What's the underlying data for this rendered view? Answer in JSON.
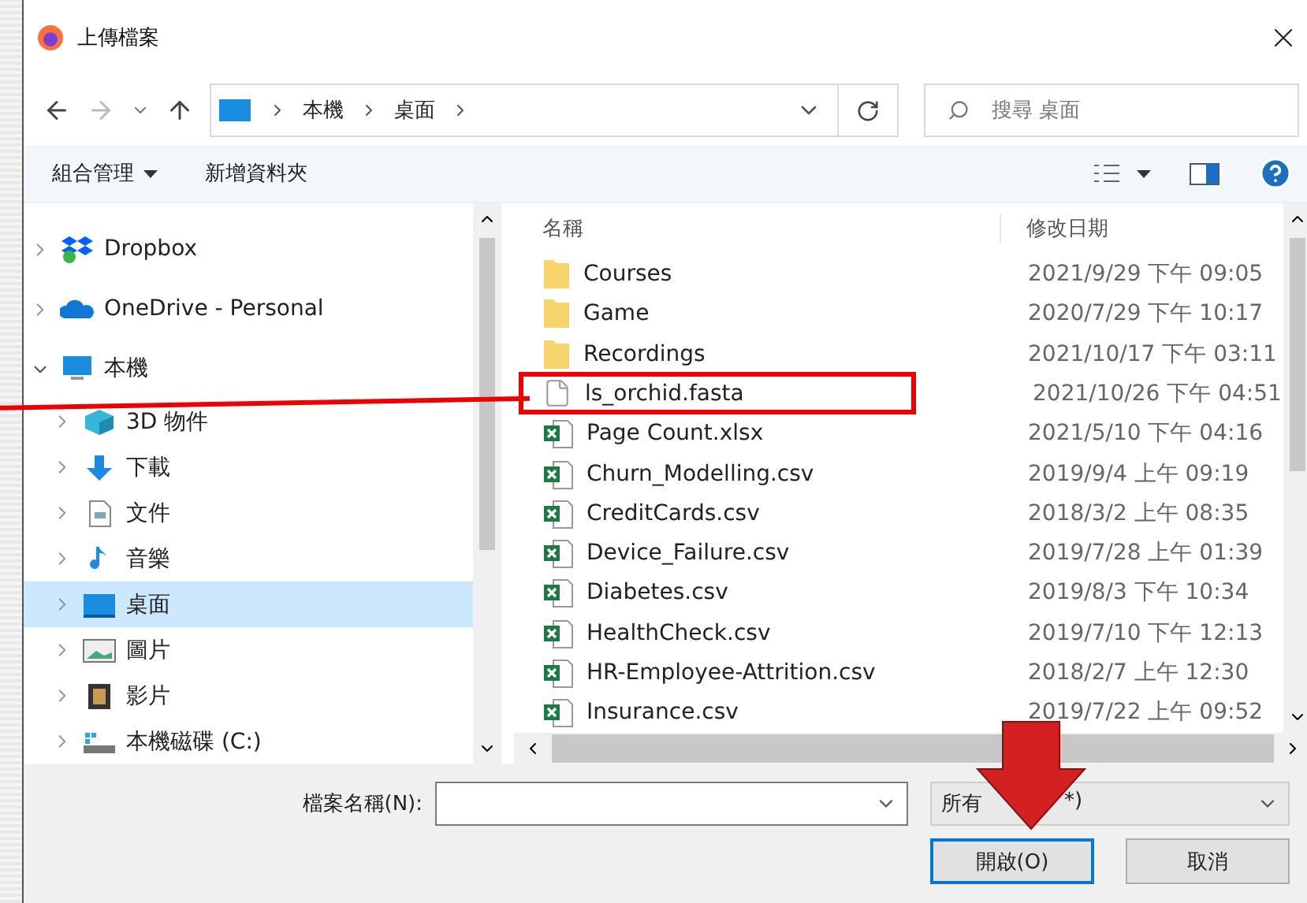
{
  "window": {
    "title": "上傳檔案"
  },
  "address_bar": {
    "path": [
      "本機",
      "桌面"
    ]
  },
  "search": {
    "placeholder": "搜尋 桌面"
  },
  "toolbar": {
    "organize": "組合管理",
    "new_folder": "新增資料夾"
  },
  "sidebar": {
    "items": [
      {
        "label": "Dropbox",
        "kind": "dropbox",
        "expanded": false,
        "selected": false
      },
      {
        "label": "OneDrive - Personal",
        "kind": "cloud",
        "expanded": false,
        "selected": false
      },
      {
        "label": "本機",
        "kind": "pc",
        "expanded": true,
        "selected": false,
        "children": [
          {
            "label": "3D 物件",
            "kind": "cube",
            "expanded": false,
            "selected": false
          },
          {
            "label": "下載",
            "kind": "download",
            "expanded": false,
            "selected": false
          },
          {
            "label": "文件",
            "kind": "doc",
            "expanded": false,
            "selected": false
          },
          {
            "label": "音樂",
            "kind": "music",
            "expanded": false,
            "selected": false
          },
          {
            "label": "桌面",
            "kind": "desktop",
            "expanded": false,
            "selected": true
          },
          {
            "label": "圖片",
            "kind": "image",
            "expanded": false,
            "selected": false
          },
          {
            "label": "影片",
            "kind": "film",
            "expanded": false,
            "selected": false
          },
          {
            "label": "本機磁碟 (C:)",
            "kind": "drive",
            "expanded": false,
            "selected": false
          }
        ]
      }
    ]
  },
  "file_list": {
    "columns": [
      "名稱",
      "修改日期"
    ],
    "rows": [
      {
        "name": "Courses",
        "kind": "folder",
        "modified": "2021/9/29 下午 09:05",
        "highlighted": false
      },
      {
        "name": "Game",
        "kind": "folder",
        "modified": "2020/7/29 下午 10:17",
        "highlighted": false
      },
      {
        "name": "Recordings",
        "kind": "folder",
        "modified": "2021/10/17 下午 03:11",
        "highlighted": false
      },
      {
        "name": "ls_orchid.fasta",
        "kind": "file",
        "modified": "2021/10/26 下午 04:51",
        "highlighted": true
      },
      {
        "name": "Page Count.xlsx",
        "kind": "excel",
        "modified": "2021/5/10 下午 04:16",
        "highlighted": false
      },
      {
        "name": "Churn_Modelling.csv",
        "kind": "excel",
        "modified": "2019/9/4 上午 09:19",
        "highlighted": false
      },
      {
        "name": "CreditCards.csv",
        "kind": "excel",
        "modified": "2018/3/2 上午 08:35",
        "highlighted": false
      },
      {
        "name": "Device_Failure.csv",
        "kind": "excel",
        "modified": "2019/7/28 上午 01:39",
        "highlighted": false
      },
      {
        "name": "Diabetes.csv",
        "kind": "excel",
        "modified": "2019/8/3 下午 10:34",
        "highlighted": false
      },
      {
        "name": "HealthCheck.csv",
        "kind": "excel",
        "modified": "2019/7/10 下午 12:13",
        "highlighted": false
      },
      {
        "name": "HR-Employee-Attrition.csv",
        "kind": "excel",
        "modified": "2018/2/7 上午 12:30",
        "highlighted": false
      },
      {
        "name": "Insurance.csv",
        "kind": "excel",
        "modified": "2019/7/22 上午 09:52",
        "highlighted": false
      }
    ]
  },
  "footer": {
    "filename_label": "檔案名稱(N):",
    "file_type": [
      "所有",
      "*)"
    ],
    "open": "開啟(O)",
    "cancel": "取消"
  }
}
